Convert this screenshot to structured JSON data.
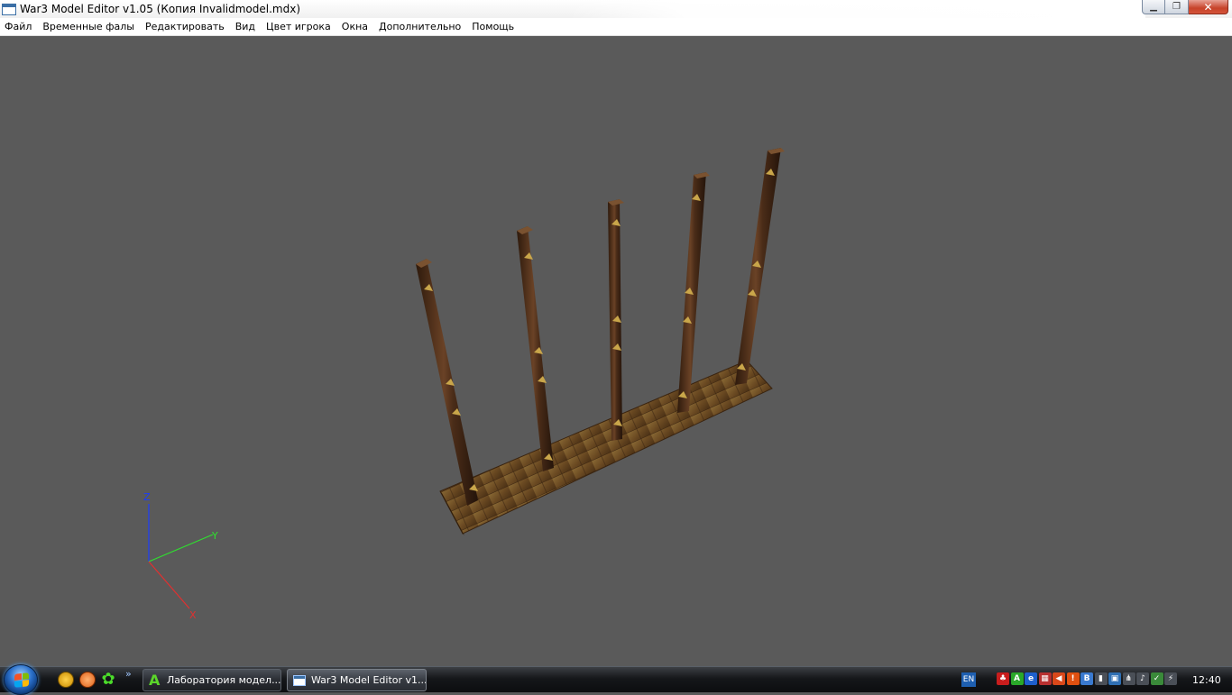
{
  "window": {
    "title": "War3 Model Editor v1.05 (Копия Invalidmodel.mdx)",
    "controls": {
      "minimize": "▁",
      "maximize": "❐",
      "close": "✕"
    }
  },
  "menu": {
    "items": [
      "Файл",
      "Временные фалы",
      "Редактировать",
      "Вид",
      "Цвет игрока",
      "Окна",
      "Дополнительно",
      "Помощь"
    ]
  },
  "viewport": {
    "background": "#5a5a5a",
    "axes": {
      "z_label": "Z",
      "y_label": "Y",
      "x_label": "X",
      "z_color": "#1a3cff",
      "y_color": "#2fe02f",
      "x_color": "#e03030"
    },
    "model": {
      "platform_color": "#6b4a22",
      "post_color": "#4a2c18",
      "band_color": "#c9a64a"
    }
  },
  "taskbar": {
    "start_icon": "windows-orb-icon",
    "quick_launch_more": "»",
    "tasks": [
      {
        "label": "Лаборатория модел...",
        "icon": "lab-app-icon"
      },
      {
        "label": "War3 Model Editor v1...",
        "icon": "window-app-icon"
      }
    ],
    "tray": {
      "language": "EN",
      "icons": [
        {
          "name": "red-flag-icon",
          "color": "#c81d1d",
          "glyph": "♣"
        },
        {
          "name": "green-a-icon",
          "color": "#2aa82a",
          "glyph": "A"
        },
        {
          "name": "blue-e-icon",
          "color": "#1e5fcc",
          "glyph": "e"
        },
        {
          "name": "usa-flag-icon",
          "color": "#b83030",
          "glyph": "▦"
        },
        {
          "name": "speaker-red-icon",
          "color": "#d9481a",
          "glyph": "◀"
        },
        {
          "name": "warning-icon",
          "color": "#e05010",
          "glyph": "!"
        },
        {
          "name": "b-icon",
          "color": "#3a7ad0",
          "glyph": "B"
        },
        {
          "name": "signal-bars-icon",
          "color": "#4a4f57",
          "glyph": "▮"
        },
        {
          "name": "network-icon",
          "color": "#2f6fb3",
          "glyph": "▣"
        },
        {
          "name": "wifi-icon",
          "color": "#4a4f57",
          "glyph": "⋔"
        },
        {
          "name": "volume-icon",
          "color": "#4a4f57",
          "glyph": "♪"
        },
        {
          "name": "safely-remove-icon",
          "color": "#3a8a3a",
          "glyph": "✓"
        },
        {
          "name": "power-icon",
          "color": "#4a4f57",
          "glyph": "⚡"
        }
      ]
    },
    "clock": "12:40"
  }
}
